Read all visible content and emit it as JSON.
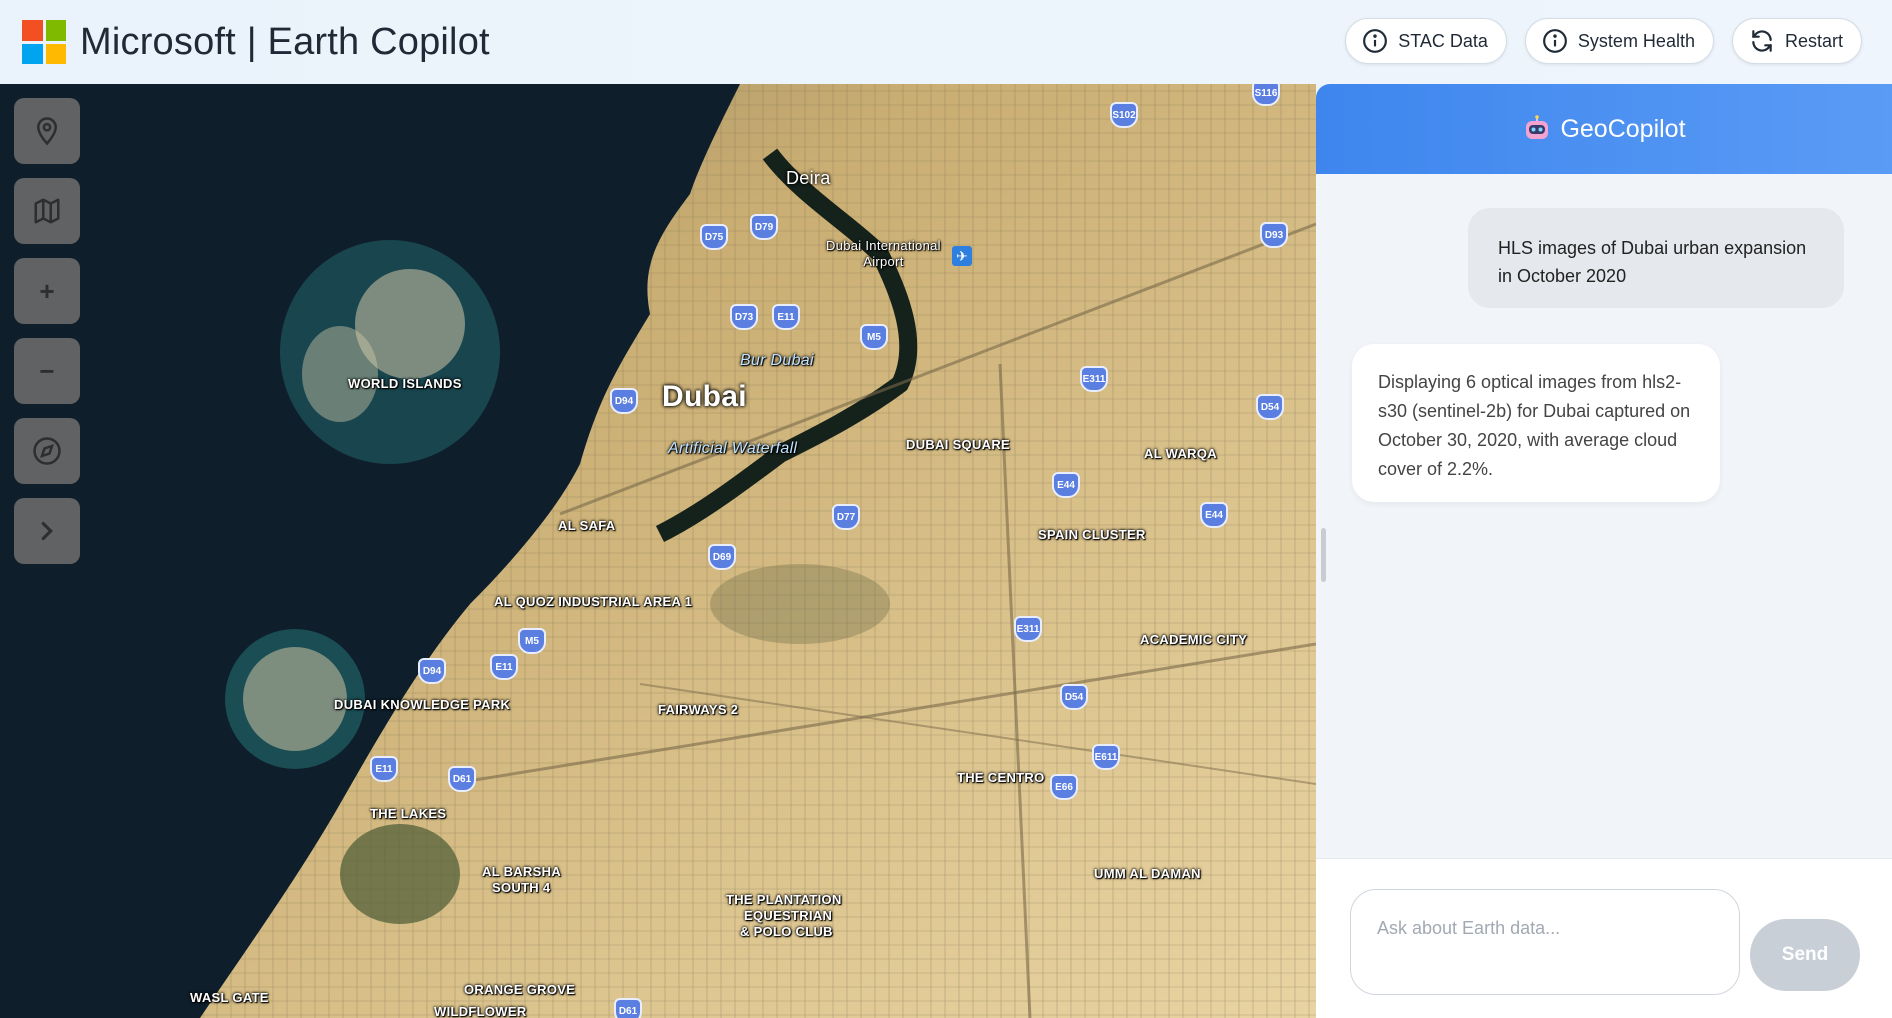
{
  "header": {
    "title": "Microsoft | Earth Copilot",
    "buttons": [
      {
        "label": "STAC Data",
        "icon": "info-icon"
      },
      {
        "label": "System Health",
        "icon": "info-icon"
      },
      {
        "label": "Restart",
        "icon": "refresh-icon"
      }
    ]
  },
  "map": {
    "tools": [
      {
        "name": "location-pin-icon"
      },
      {
        "name": "map-icon"
      },
      {
        "name": "zoom-in",
        "symbol": "+"
      },
      {
        "name": "zoom-out",
        "symbol": "−"
      },
      {
        "name": "compass-icon"
      },
      {
        "name": "chevron-right-icon"
      }
    ],
    "labels": {
      "deira": "Deira",
      "airport": "Dubai International\nAirport",
      "bur_dubai": "Bur Dubai",
      "dubai": "Dubai",
      "waterfall": "Artificial Waterfall",
      "world_islands": "WORLD ISLANDS",
      "dubai_square": "DUBAI SQUARE",
      "al_warqa": "AL WARQA",
      "al_safa": "AL SAFA",
      "spain_cluster": "SPAIN CLUSTER",
      "al_quoz": "AL QUOZ INDUSTRIAL AREA 1",
      "academic_city": "ACADEMIC CITY",
      "knowledge_park": "DUBAI KNOWLEDGE PARK",
      "fairways": "FAIRWAYS 2",
      "the_centro": "THE CENTRO",
      "the_lakes": "THE LAKES",
      "al_barsha_1": "AL BARSHA",
      "al_barsha_2": "SOUTH 4",
      "umm_al_daman": "UMM AL DAMAN",
      "plantation_1": "THE PLANTATION",
      "plantation_2": "EQUESTRIAN",
      "plantation_3": "& POLO CLUB",
      "wasl_gate": "WASL GATE",
      "orange_grove": "ORANGE GROVE",
      "wildflower": "WILDFLOWER"
    },
    "shields": [
      "S116",
      "S102",
      "D93",
      "D75",
      "D79",
      "D73",
      "E11",
      "M5",
      "E311",
      "D54",
      "D94",
      "E44",
      "E44",
      "D77",
      "D69",
      "E311",
      "M5",
      "E11",
      "D94",
      "D54",
      "E611",
      "E66",
      "E11",
      "D61",
      "D61"
    ]
  },
  "chat": {
    "title": "GeoCopilot",
    "messages": [
      {
        "role": "user",
        "text": "HLS images of Dubai urban expansion in October 2020"
      },
      {
        "role": "assistant",
        "text": "Displaying 6 optical images from hls2-s30 (sentinel-2b) for Dubai captured on October 30, 2020, with average cloud cover of 2.2%."
      }
    ],
    "input_placeholder": "Ask about Earth data...",
    "input_value": "",
    "send_label": "Send"
  }
}
